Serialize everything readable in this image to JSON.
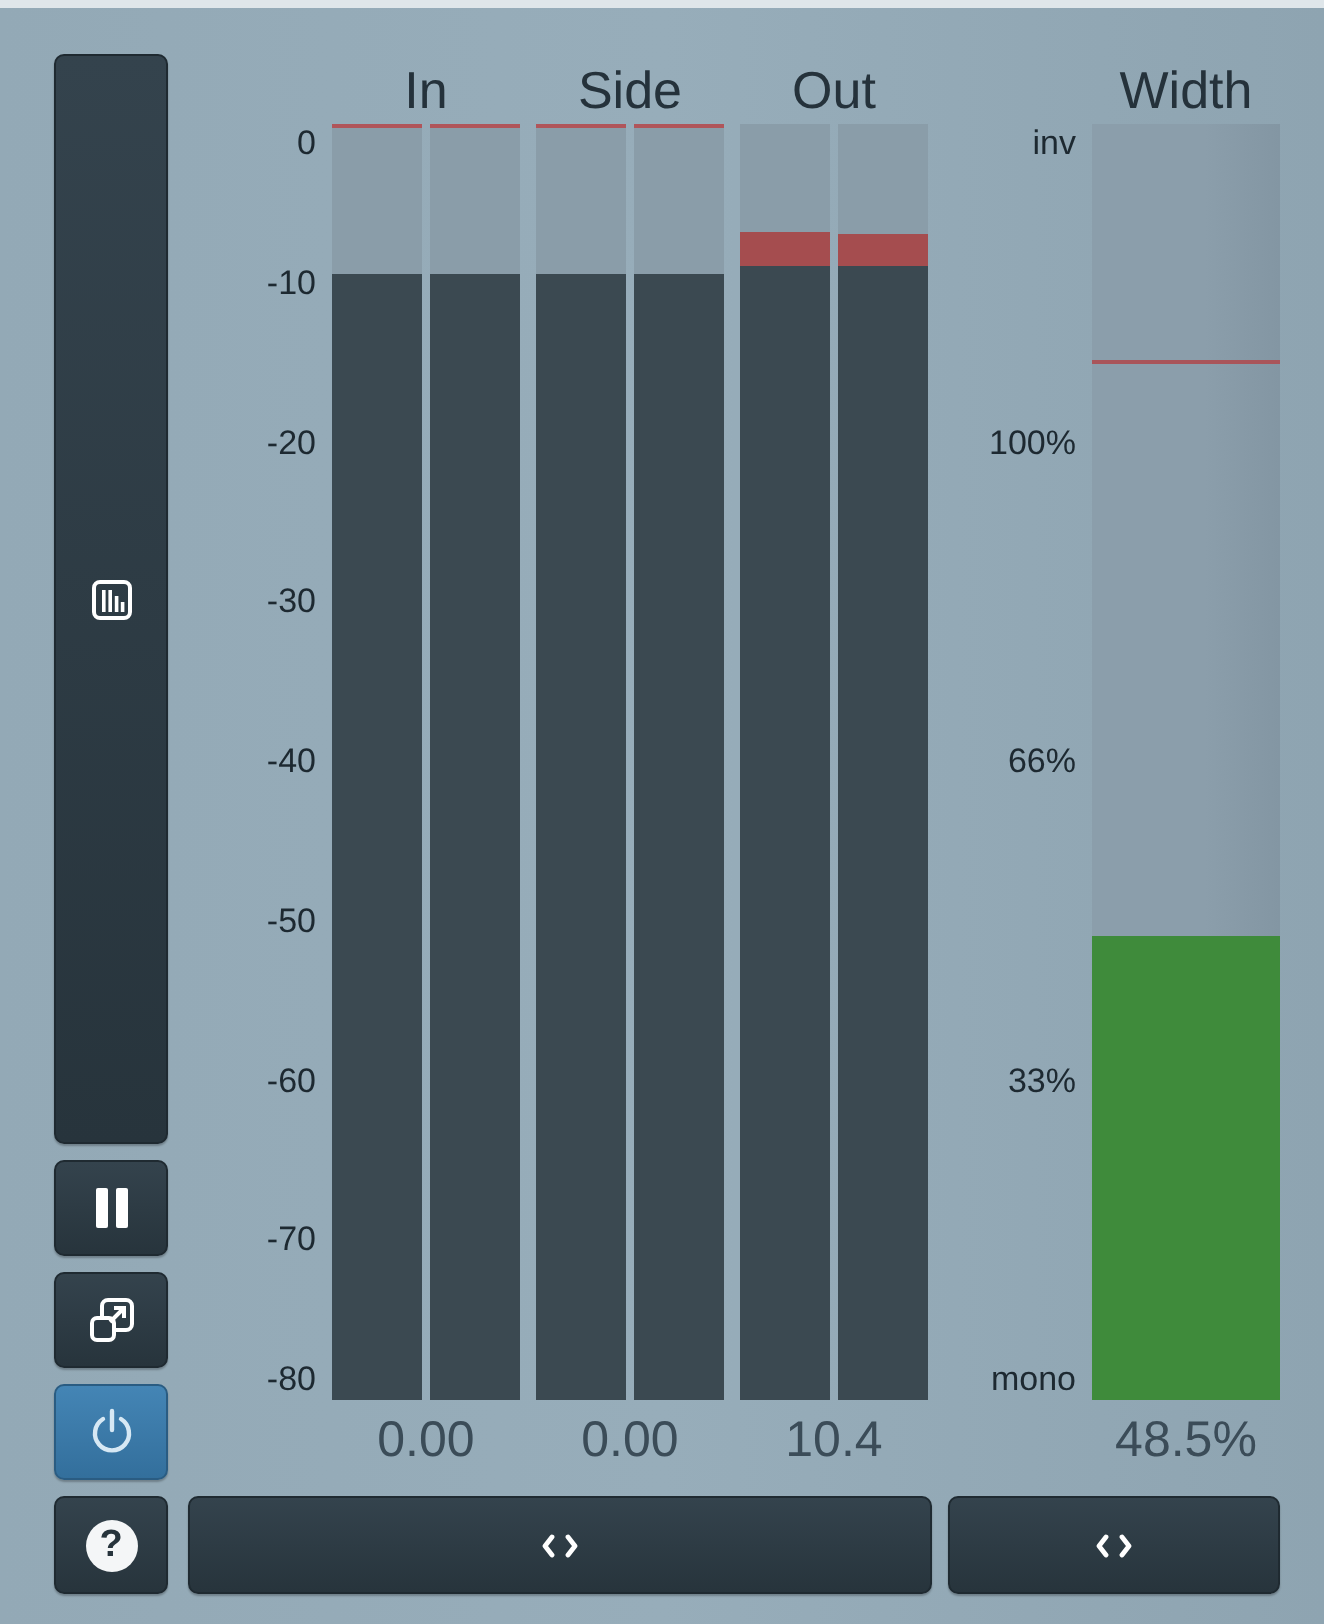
{
  "sidebar": {
    "buttons": [
      {
        "kind": "meters",
        "on": false
      },
      {
        "kind": "pause",
        "on": false
      },
      {
        "kind": "resize",
        "on": false
      },
      {
        "kind": "power",
        "on": true
      }
    ],
    "help": {
      "label": "?"
    }
  },
  "scale": {
    "labels": [
      "0",
      "-10",
      "-20",
      "-30",
      "-40",
      "-50",
      "-60",
      "-70",
      "-80"
    ]
  },
  "meters": [
    {
      "title": "In",
      "readout": "0.00",
      "channels": [
        {
          "level": 0.882,
          "peak_line": true
        },
        {
          "level": 0.882,
          "peak_line": true
        }
      ]
    },
    {
      "title": "Side",
      "readout": "0.00",
      "channels": [
        {
          "level": 0.882,
          "peak_line": true
        },
        {
          "level": 0.882,
          "peak_line": true
        }
      ]
    },
    {
      "title": "Out",
      "readout": "10.4",
      "channels": [
        {
          "level": 0.889,
          "peak_line": false,
          "peak": {
            "level": 0.915
          }
        },
        {
          "level": 0.889,
          "peak_line": false,
          "peak": {
            "level": 0.914
          }
        }
      ]
    }
  ],
  "width": {
    "title": "Width",
    "scale": [
      "inv",
      "100%",
      "66%",
      "33%",
      "mono"
    ],
    "level": 0.364,
    "marker": {
      "level": 0.813
    },
    "readout": "48.5%"
  },
  "footer_buttons": [
    {
      "kind": "left-right"
    },
    {
      "kind": "left-right"
    }
  ]
}
